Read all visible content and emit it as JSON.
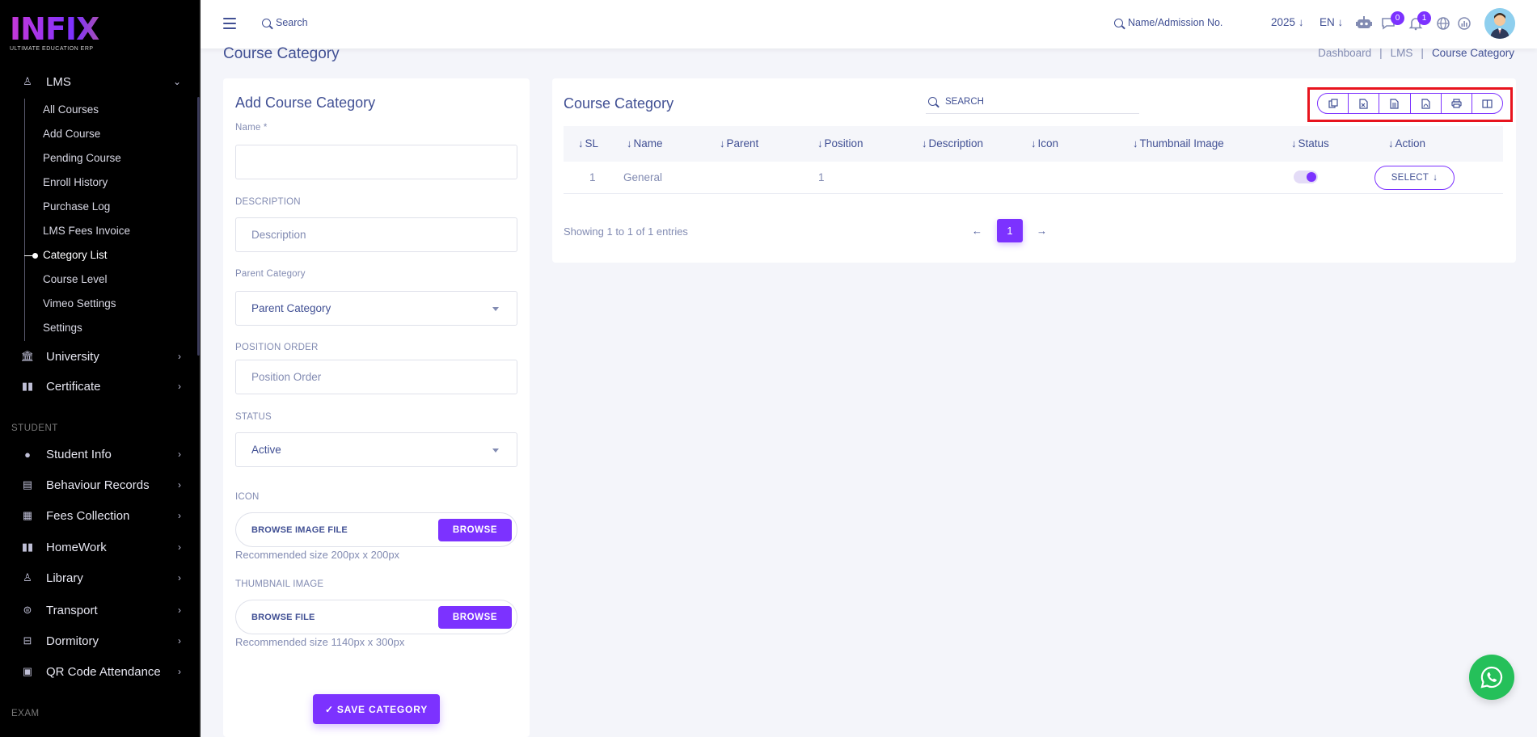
{
  "app": {
    "logo_text": "INFIX",
    "logo_subtitle": "ULTIMATE EDUCATION ERP"
  },
  "sidebar": {
    "lms_label": "LMS",
    "lms_subitems": [
      {
        "label": "All Courses"
      },
      {
        "label": "Add Course"
      },
      {
        "label": "Pending Course"
      },
      {
        "label": "Enroll History"
      },
      {
        "label": "Purchase Log"
      },
      {
        "label": "LMS Fees Invoice"
      },
      {
        "label": "Category List",
        "active": true
      },
      {
        "label": "Course Level"
      },
      {
        "label": "Vimeo Settings"
      },
      {
        "label": "Settings"
      }
    ],
    "items_top": [
      {
        "label": "University",
        "icon": "bank-icon"
      },
      {
        "label": "Certificate",
        "icon": "book-open-icon"
      }
    ],
    "section_student": "STUDENT",
    "items_student": [
      {
        "label": "Student Info",
        "icon": "user-icon"
      },
      {
        "label": "Behaviour Records",
        "icon": "files-icon"
      },
      {
        "label": "Fees Collection",
        "icon": "money-icon"
      },
      {
        "label": "HomeWork",
        "icon": "book-icon"
      },
      {
        "label": "Library",
        "icon": "library-icon"
      },
      {
        "label": "Transport",
        "icon": "bus-icon"
      },
      {
        "label": "Dormitory",
        "icon": "bed-icon"
      },
      {
        "label": "QR Code Attendance",
        "icon": "qr-icon"
      }
    ],
    "section_exam": "EXAM"
  },
  "header": {
    "search_label": "Search",
    "student_search_label": "Name/Admission No.",
    "year": "2025",
    "language": "EN",
    "chat_badge": "0",
    "notification_badge": "1"
  },
  "page": {
    "title": "Course Category",
    "breadcrumb": [
      "Dashboard",
      "LMS",
      "Course Category"
    ]
  },
  "form": {
    "title": "Add Course Category",
    "name_label": "Name *",
    "name_value": "",
    "description_label": "DESCRIPTION",
    "description_placeholder": "Description",
    "parent_label": "Parent Category",
    "parent_value": "Parent Category",
    "position_label": "POSITION ORDER",
    "position_placeholder": "Position Order",
    "status_label": "STATUS",
    "status_value": "Active",
    "icon_label": "ICON",
    "icon_placeholder": "BROWSE IMAGE FILE",
    "icon_browse": "BROWSE",
    "icon_hint": "Recommended size 200px x 200px",
    "thumb_label": "THUMBNAIL IMAGE",
    "thumb_placeholder": "BROWSE FILE",
    "thumb_browse": "BROWSE",
    "thumb_hint": "Recommended size 1140px x 300px",
    "save_label": "SAVE CATEGORY"
  },
  "table": {
    "title": "Course Category",
    "search_placeholder": "SEARCH",
    "export_tools": [
      "copy-icon",
      "excel-icon",
      "csv-icon",
      "pdf-icon",
      "print-icon",
      "columns-icon"
    ],
    "columns": [
      "SL",
      "Name",
      "Parent",
      "Position",
      "Description",
      "Icon",
      "Thumbnail Image",
      "Status",
      "Action"
    ],
    "rows": [
      {
        "sl": "1",
        "name": "General",
        "parent": "",
        "position": "1",
        "description": "",
        "status_on": true,
        "action": "SELECT"
      }
    ],
    "showing": "Showing 1 to 1 of 1 entries",
    "current_page": "1"
  },
  "colors": {
    "accent": "#7c32ff",
    "text_primary": "#415094",
    "text_muted": "#828bb2",
    "highlight_frame": "#e8141e",
    "whatsapp": "#25c05a"
  }
}
